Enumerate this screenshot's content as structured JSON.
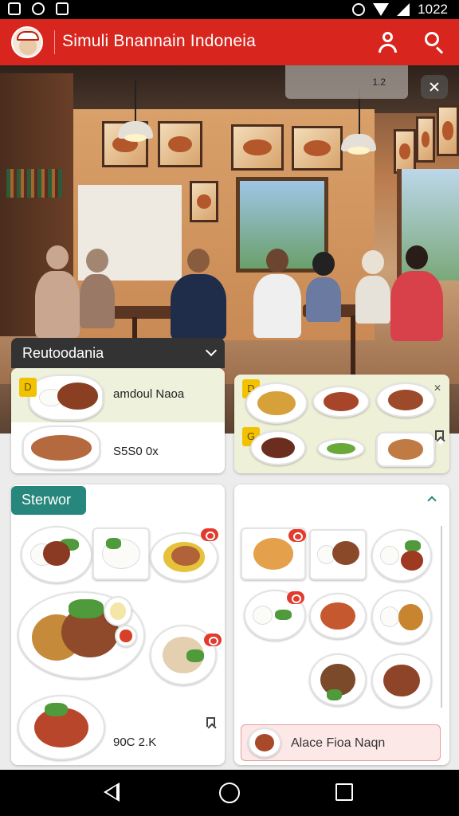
{
  "status_bar": {
    "time": "1022"
  },
  "app_bar": {
    "title": "Simuli Bnannain Indoneia"
  },
  "hero": {
    "video_counter": "1.2"
  },
  "section_dropdown": {
    "label": "Reutoodania"
  },
  "top_card_left": {
    "badge": "D",
    "name": "amdoul Naoa",
    "price": "S5S0 0x"
  },
  "top_card_right": {
    "badge_top": "D",
    "badge_bottom": "G"
  },
  "store_section": {
    "tag": "Sterwor",
    "price": "90C 2.K"
  },
  "right_panel": {
    "detail_label": "Alace Fioa Naqn"
  },
  "colors": {
    "accent": "#d8261e",
    "teal": "#27877d",
    "badge_yellow": "#f2c200"
  },
  "icons": [
    "user-icon",
    "search-icon",
    "close-icon",
    "chevron-down-icon",
    "bookmark-icon",
    "back-icon",
    "home-icon",
    "recent-apps-icon"
  ]
}
